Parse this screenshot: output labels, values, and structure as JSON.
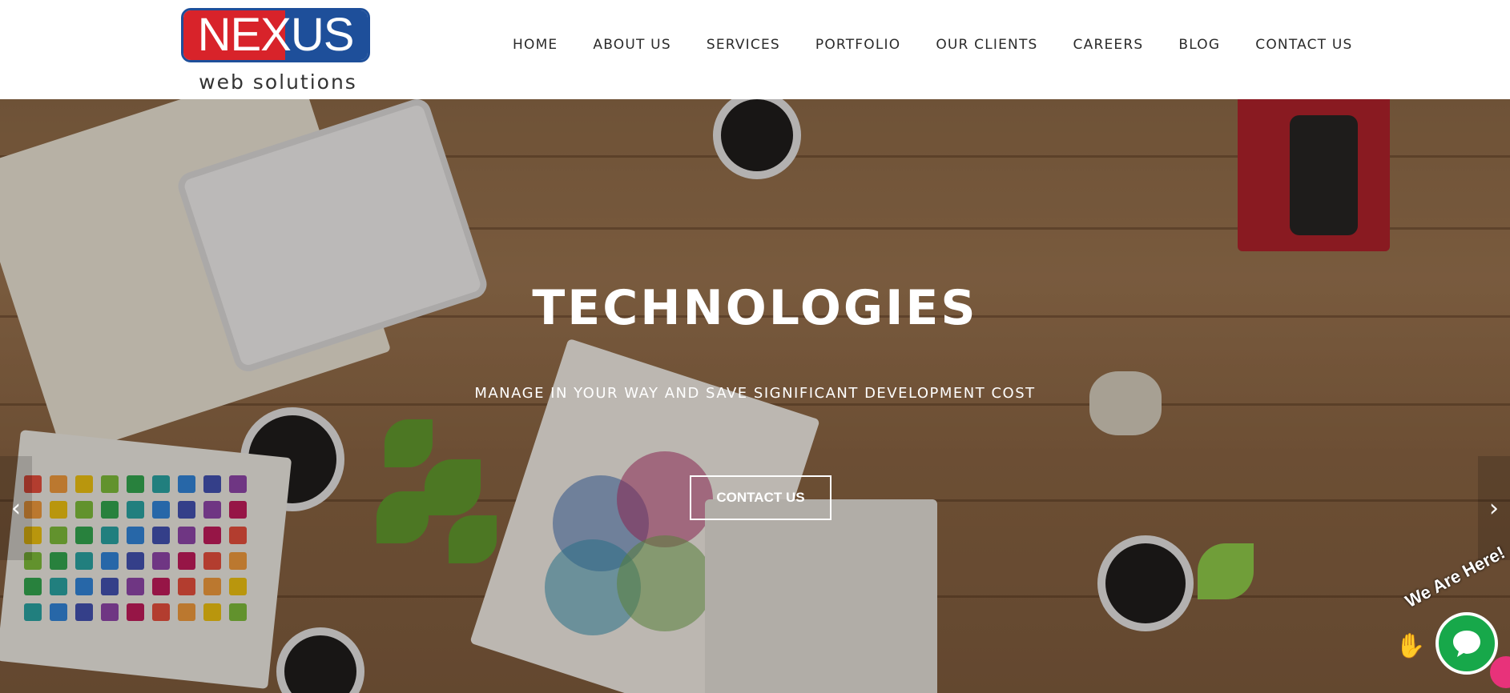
{
  "header": {
    "logo": {
      "word": "NEXUS",
      "tagline": "web solutions"
    },
    "nav": [
      {
        "label": "HOME"
      },
      {
        "label": "ABOUT US"
      },
      {
        "label": "SERVICES"
      },
      {
        "label": "PORTFOLIO"
      },
      {
        "label": "OUR CLIENTS"
      },
      {
        "label": "CAREERS"
      },
      {
        "label": "BLOG"
      },
      {
        "label": "CONTACT US"
      }
    ]
  },
  "hero": {
    "title": "TECHNOLOGIES",
    "subtitle": "MANAGE IN YOUR WAY AND SAVE SIGNIFICANT DEVELOPMENT COST",
    "cta_label": "CONTACT US",
    "prev_icon": "chevron-left-icon",
    "next_icon": "chevron-right-icon"
  },
  "chat": {
    "tagline": "We Are Here!",
    "icon": "chat-bubble-icon"
  },
  "colors": {
    "brand_red": "#d8232a",
    "brand_blue": "#1e4f9a",
    "chat_green": "#17a84a"
  }
}
